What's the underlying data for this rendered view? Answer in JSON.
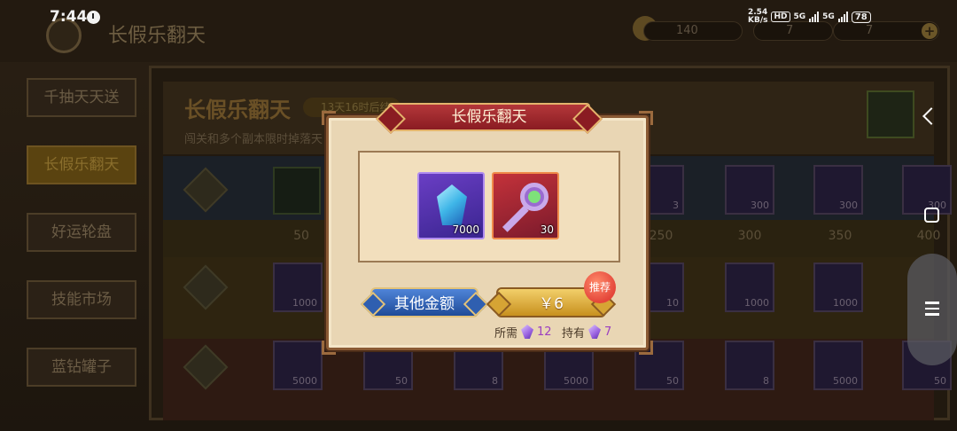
{
  "status_bar": {
    "time": "7:44",
    "net_speed": "2.54",
    "net_speed_unit": "KB/s",
    "hd": "HD",
    "net1": "5G",
    "net2": "5G",
    "battery": "78"
  },
  "background": {
    "page_title": "长假乐翻天",
    "resources": [
      {
        "value": "140"
      },
      {
        "value": "7"
      },
      {
        "value": "7"
      }
    ],
    "side_menu": [
      "千抽天天送",
      "长假乐翻天",
      "好运轮盘",
      "技能市场",
      "蓝钻罐子"
    ],
    "active_menu_index": 1,
    "event_title": "长假乐翻天",
    "event_timer": "13天16时后结",
    "event_desc": "闯关和多个副本限时掉落天",
    "milestones": [
      "50",
      "250",
      "300",
      "350",
      "400"
    ],
    "row_counts_top": [
      "3",
      "300",
      "300",
      "300"
    ],
    "row_counts_mid": [
      "1000",
      "10",
      "1000",
      "1000"
    ],
    "row_counts_bottom": [
      "5000",
      "50",
      "8",
      "5000",
      "50",
      "8",
      "5000",
      "50"
    ]
  },
  "modal": {
    "title": "长假乐翻天",
    "rewards": [
      {
        "name": "crystal",
        "count": "7000"
      },
      {
        "name": "key",
        "count": "30"
      }
    ],
    "other_amount_label": "其他金额",
    "pay_label": "￥6",
    "recommend_badge": "推荐",
    "cost_need_label": "所需",
    "cost_need_value": "12",
    "cost_have_label": "持有",
    "cost_have_value": "7"
  },
  "colors": {
    "banner_red": "#a62a30",
    "gold": "#e4b46c",
    "panel_cream": "#e9d6b4",
    "blue_button": "#2f5fb0",
    "gold_button": "#d6a434",
    "badge_red": "#e4463a",
    "gem_purple": "#9b3ec0"
  }
}
